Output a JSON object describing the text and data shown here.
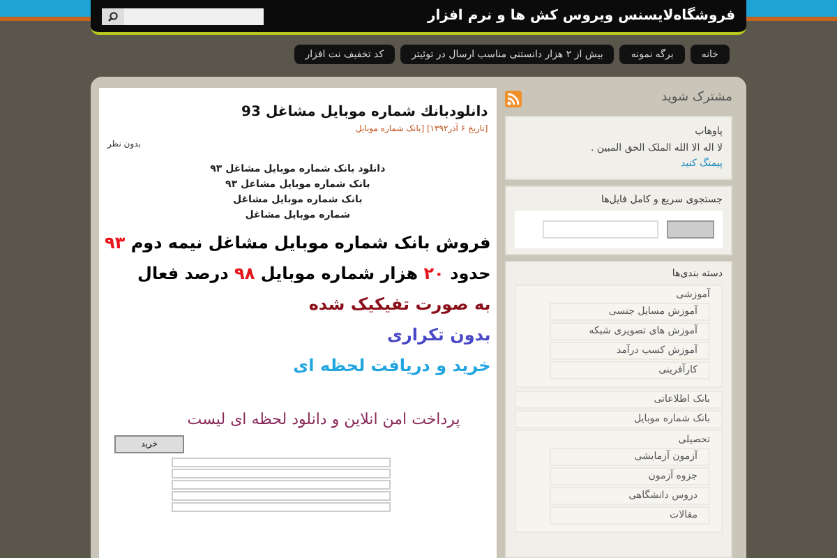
{
  "header": {
    "title": "فروشگاه‌لایسنس ویروس کش ها و نرم افزار"
  },
  "nav": [
    {
      "label": "خانه",
      "selected": false
    },
    {
      "label": "برگه نمونه",
      "selected": false
    },
    {
      "label": "بیش از ۲ هزار دانستنی مناسب ارسال در توئیتر",
      "selected": false
    },
    {
      "label": "کد تخفیف نت افزار",
      "selected": false
    }
  ],
  "post": {
    "title": "دانلودبانك شماره موبايل مشاغل 93",
    "meta": "[تاریخ ۶ آذر۱۳۹۲] [بانک شماره موبایل",
    "comments": "بدون نظر",
    "intro_lines": [
      "دانلود بانک شماره موبایل مشاغل ۹۳",
      "بانک شماره موبایل مشاغل ۹۳",
      "بانک شماره موبایل مشاغل",
      "شماره موبایل مشاغل"
    ],
    "promo_lines": [
      [
        {
          "text": "فروش بانک شماره موبایل مشاغل نیمه دوم ",
          "color": "#000000"
        },
        {
          "text": "۹۳",
          "color": "#e8141b"
        }
      ],
      [
        {
          "text": "حدود ",
          "color": "#000000"
        },
        {
          "text": "۲۰",
          "color": "#e8141b"
        },
        {
          "text": " هزار شماره موبایل ",
          "color": "#000000"
        },
        {
          "text": "۹۸",
          "color": "#e8141b"
        },
        {
          "text": " درصد فعال",
          "color": "#000000"
        }
      ],
      [
        {
          "text": "به صورت تفیکیک شده",
          "color": "#8a0f1a"
        }
      ],
      [
        {
          "text": "بدون تکراری",
          "color": "#4a4ac8"
        }
      ],
      [
        {
          "text": "خرید و دریافت لحظه ای",
          "color": "#23a6e0"
        }
      ]
    ],
    "payment_text": "پرداخت امن انلاین و دانلود لحظه ای لیست",
    "buy_button": "خرید"
  },
  "sidebar": {
    "subscribe": "مشترک شوید",
    "info": {
      "title": "پاوهاب",
      "text": "لا اله الا الله الملک الحق المبین .",
      "link": "پیمنگ کنید"
    },
    "search": {
      "title": "جستجوی سریع و کامل فایل‌ها"
    },
    "categories": {
      "title": "دسته بندی‌ها",
      "items": [
        {
          "label": "آموزشی",
          "children": [
            {
              "label": "آموزش مسایل جنسی"
            },
            {
              "label": "آموزش های تصویری شبکه"
            },
            {
              "label": "آموزش کسب درآمد"
            },
            {
              "label": "کارآفرینی"
            }
          ]
        },
        {
          "label": "بانک اطلاعاتی"
        },
        {
          "label": "بانک شماره موبایل"
        },
        {
          "label": "تحصیلی",
          "children": [
            {
              "label": "آزمون آزمایشی"
            },
            {
              "label": "جزوه آزمون"
            },
            {
              "label": "دروس دانشگاهی"
            },
            {
              "label": "مقالات"
            }
          ]
        }
      ]
    }
  }
}
